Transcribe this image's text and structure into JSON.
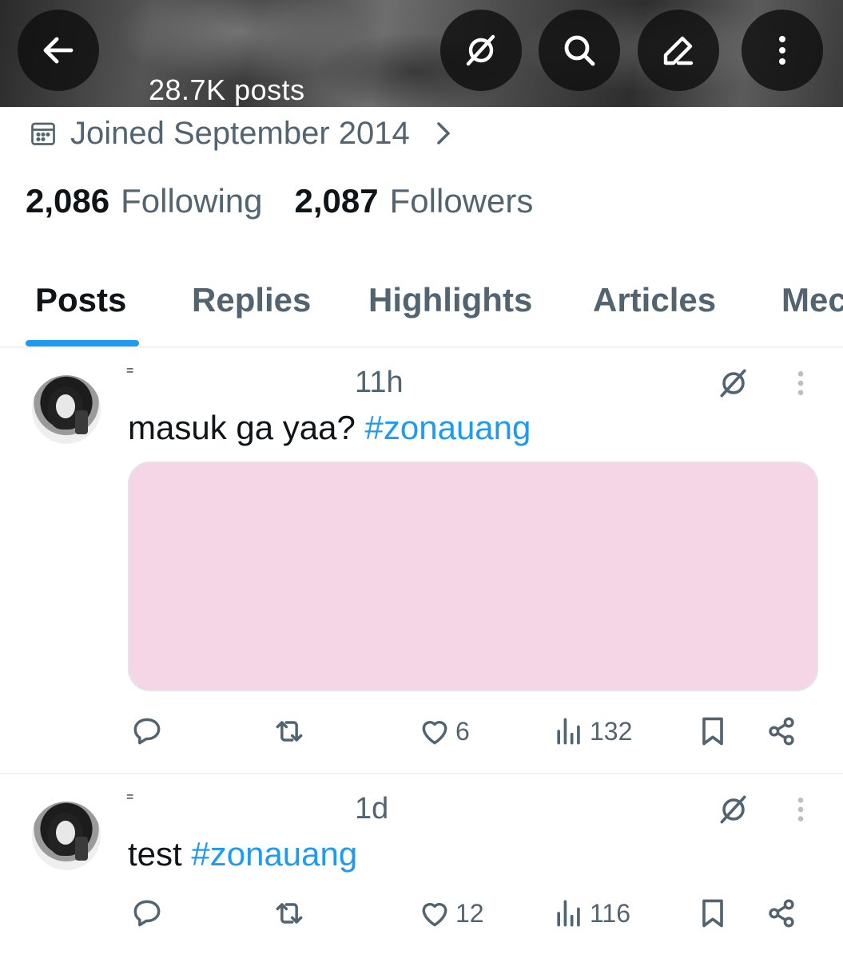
{
  "header": {
    "posts_count": "28.7K posts",
    "back_icon": "arrow-left-icon",
    "actions": [
      "grok-icon",
      "search-icon",
      "edit-icon",
      "more-vertical-icon"
    ]
  },
  "profile": {
    "joined": "Joined September 2014",
    "following_count": "2,086",
    "following_label": "Following",
    "followers_count": "2,087",
    "followers_label": "Followers"
  },
  "tabs": [
    {
      "label": "Posts",
      "active": true
    },
    {
      "label": "Replies",
      "active": false
    },
    {
      "label": "Highlights",
      "active": false
    },
    {
      "label": "Articles",
      "active": false
    },
    {
      "label": "Mec",
      "active": false
    }
  ],
  "posts": [
    {
      "name_mark": "=",
      "time": "11h",
      "text": "masuk ga yaa? ",
      "hashtag": "#zonauang",
      "has_media": true,
      "media_color": "#f4d6e6",
      "likes": "6",
      "views": "132"
    },
    {
      "name_mark": "=",
      "time": "1d",
      "text": "test ",
      "hashtag": "#zonauang",
      "has_media": false,
      "likes": "12",
      "views": "116"
    }
  ],
  "colors": {
    "accent": "#1d9bf0",
    "muted": "#536471",
    "text": "#0f1419"
  }
}
